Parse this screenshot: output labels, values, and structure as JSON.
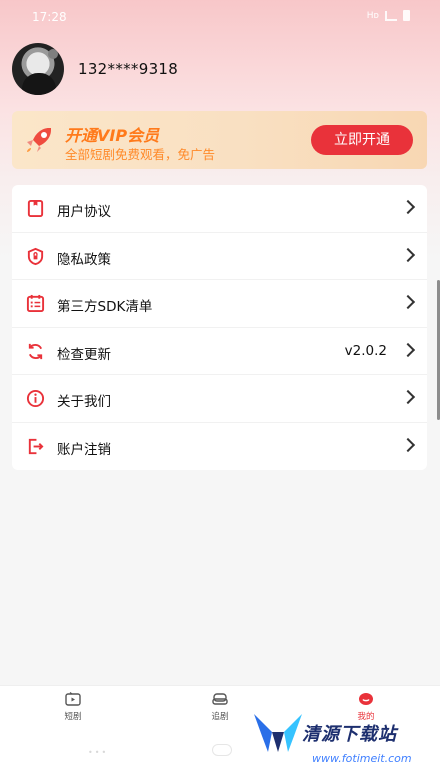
{
  "status": {
    "time": "17:28",
    "network": "Hᴅ"
  },
  "profile": {
    "phone": "132****9318"
  },
  "vip": {
    "title": "开通VIP会员",
    "subtitle": "全部短剧免费观看，免广告",
    "button": "立即开通",
    "accent": "#e9323a",
    "title_color": "#ff7a1b"
  },
  "menu": {
    "items": [
      {
        "label": "用户协议",
        "icon": "document-icon"
      },
      {
        "label": "隐私政策",
        "icon": "shield-icon"
      },
      {
        "label": "第三方SDK清单",
        "icon": "list-icon"
      },
      {
        "label": "检查更新",
        "icon": "refresh-icon",
        "value": "v2.0.2"
      },
      {
        "label": "关于我们",
        "icon": "info-icon"
      },
      {
        "label": "账户注销",
        "icon": "logout-icon"
      }
    ]
  },
  "nav": {
    "tabs": [
      {
        "label": "短剧",
        "icon": "tv-icon"
      },
      {
        "label": "追剧",
        "icon": "sofa-icon"
      },
      {
        "label": "我的",
        "icon": "profile-icon",
        "active": true
      }
    ]
  },
  "watermark": {
    "text": "清源下载站",
    "url": "www.fotimeit.com"
  }
}
